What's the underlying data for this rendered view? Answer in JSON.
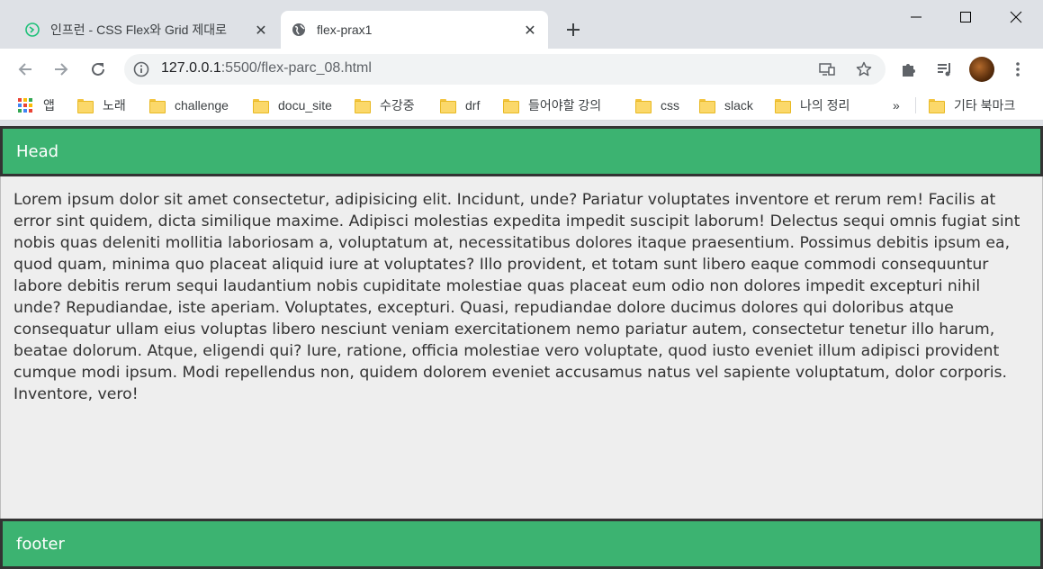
{
  "browser": {
    "tabs": [
      {
        "title": "인프런 - CSS Flex와 Grid 제대로",
        "active": false
      },
      {
        "title": "flex-prax1",
        "active": true
      }
    ],
    "url_host": "127.0.0.1",
    "url_rest": ":5500/flex-parc_08.html",
    "bookmarks": {
      "apps": "앱",
      "items": [
        "노래",
        "challenge",
        "docu_site",
        "수강중",
        "drf",
        "들어야할 강의",
        "css",
        "slack",
        "나의 정리"
      ],
      "overflow": "»",
      "other": "기타 북마크"
    }
  },
  "page": {
    "head": "Head",
    "body_text": "Lorem ipsum dolor sit amet consectetur, adipisicing elit. Incidunt, unde? Pariatur voluptates inventore et rerum rem! Facilis at error sint quidem, dicta similique maxime. Adipisci molestias expedita impedit suscipit laborum! Delectus sequi omnis fugiat sint nobis quas deleniti mollitia laboriosam a, voluptatum at, necessitatibus dolores itaque praesentium. Possimus debitis ipsum ea, quod quam, minima quo placeat aliquid iure at voluptates? Illo provident, et totam sunt libero eaque commodi consequuntur labore debitis rerum sequi laudantium nobis cupiditate molestiae quas placeat eum odio non dolores impedit excepturi nihil unde? Repudiandae, iste aperiam. Voluptates, excepturi. Quasi, repudiandae dolore ducimus dolores qui doloribus atque consequatur ullam eius voluptas libero nesciunt veniam exercitationem nemo pariatur autem, consectetur tenetur illo harum, beatae dolorum. Atque, eligendi qui? Iure, ratione, officia molestiae vero voluptate, quod iusto eveniet illum adipisci provident cumque modi ipsum. Modi repellendus non, quidem dolorem eveniet accusamus natus vel sapiente voluptatum, dolor corporis. Inventore, vero!",
    "footer": "footer"
  },
  "colors": {
    "accent_green": "#3cb371",
    "border_dark": "#333333",
    "content_bg": "#eeeeee"
  }
}
